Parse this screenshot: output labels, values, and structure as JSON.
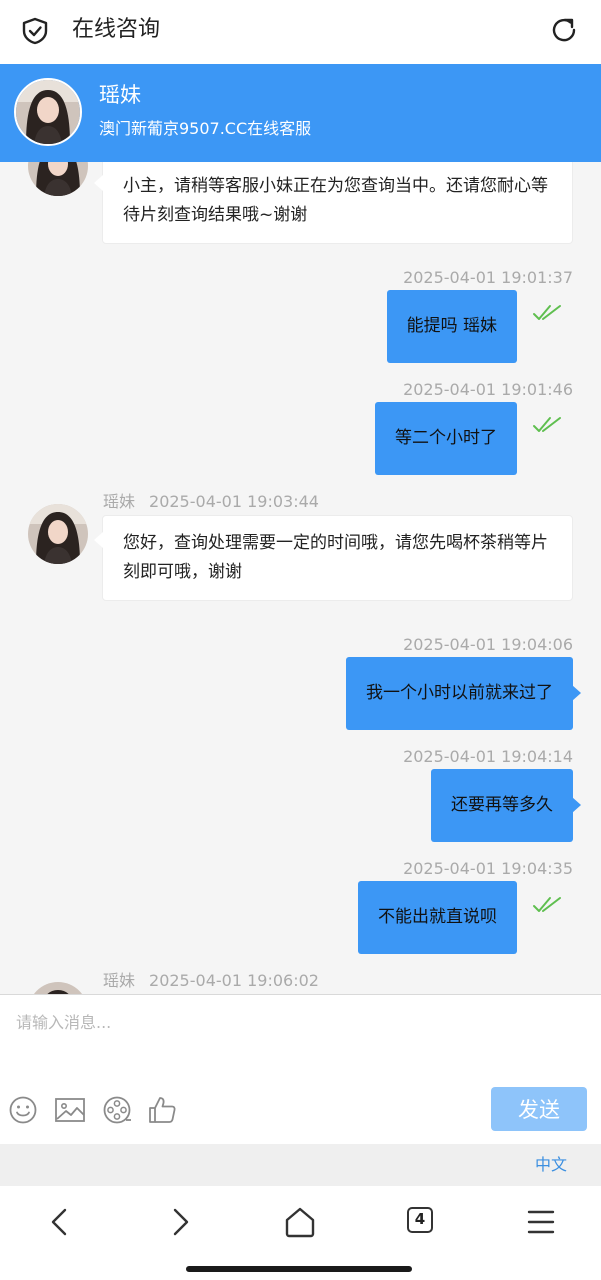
{
  "topbar": {
    "title": "在线咨询"
  },
  "agent": {
    "name": "瑶妹",
    "subtitle": "澳门新葡京9507.CC在线客服"
  },
  "messages": [
    {
      "text": "小主，请稍等客服小妹正在为您查询当中。还请您耐心等待片刻查询结果哦~谢谢"
    },
    {
      "time": "2025-04-01 19:01:37",
      "text": "能提吗 瑶妹"
    },
    {
      "time": "2025-04-01 19:01:46",
      "text": "等二个小时了"
    },
    {
      "sender": "瑶妹",
      "time": "2025-04-01 19:03:44",
      "text": "您好，查询处理需要一定的时间哦，请您先喝杯茶稍等片刻即可哦，谢谢"
    },
    {
      "time": "2025-04-01 19:04:06",
      "text": "我一个小时以前就来过了"
    },
    {
      "time": "2025-04-01 19:04:14",
      "text": "还要再等多久"
    },
    {
      "time": "2025-04-01 19:04:35",
      "text": "不能出就直说呗"
    },
    {
      "sender": "瑶妹",
      "time": "2025-04-01 19:06:02"
    }
  ],
  "composer": {
    "placeholder": "请输入消息...",
    "send_label": "发送"
  },
  "language": "中文",
  "browser": {
    "tab_count": "4"
  },
  "colors": {
    "accent": "#3c97f5",
    "send_disabled": "#8ec4fa",
    "check": "#5fbf4f"
  },
  "icons": [
    "shield-check-icon",
    "refresh-icon",
    "emoji-icon",
    "image-icon",
    "video-icon",
    "thumbs-up-icon",
    "back-icon",
    "forward-icon",
    "home-icon",
    "tabs-icon",
    "menu-icon"
  ]
}
